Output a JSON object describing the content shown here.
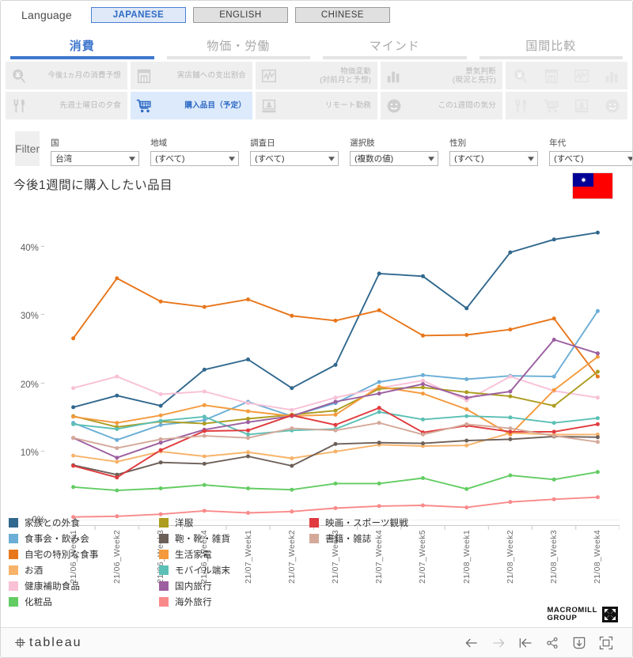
{
  "language": {
    "label": "Language",
    "options": [
      {
        "label": "JAPANESE",
        "active": true
      },
      {
        "label": "ENGLISH",
        "active": false
      },
      {
        "label": "CHINESE",
        "active": false
      }
    ]
  },
  "tabs": [
    {
      "label": "消費",
      "active": true
    },
    {
      "label": "物価・労働",
      "active": false
    },
    {
      "label": "マインド",
      "active": false
    },
    {
      "label": "国間比較",
      "active": false
    }
  ],
  "button_rows": [
    [
      {
        "label": "今後1ヵ月の消費予想",
        "icon": "yen-magnifier-icon",
        "selected": false
      },
      {
        "label": "実店舗への支出割合",
        "icon": "store-icon",
        "selected": false
      },
      {
        "label": "物価変動\n(対前月と予想)",
        "icon": "line-chart-icon",
        "selected": false
      },
      {
        "label": "景気判断\n(現況と先行)",
        "icon": "bar-chart-icon",
        "selected": false
      },
      {
        "label": "",
        "icon": "icon-set-row1",
        "selected": false
      }
    ],
    [
      {
        "label": "先週土曜日の夕食",
        "icon": "cutlery-icon",
        "selected": false
      },
      {
        "label": "購入品目（予定）",
        "icon": "shopping-cart-icon",
        "selected": true
      },
      {
        "label": "リモート勤務",
        "icon": "laptop-person-icon",
        "selected": false
      },
      {
        "label": "この1週間の気分",
        "icon": "smiley-icon",
        "selected": false
      },
      {
        "label": "",
        "icon": "icon-set-row2",
        "selected": false
      }
    ]
  ],
  "filter": {
    "tag_label": "Filter",
    "controls": [
      {
        "label": "国",
        "value": "台湾"
      },
      {
        "label": "地域",
        "value": "(すべて)"
      },
      {
        "label": "調査日",
        "value": "(すべて)"
      },
      {
        "label": "選択肢",
        "value": "(複数の値)"
      },
      {
        "label": "性別",
        "value": "(すべて)"
      },
      {
        "label": "年代",
        "value": "(すべて)"
      }
    ]
  },
  "flag": {
    "name": "taiwan-flag",
    "red": "#fe0000",
    "blue": "#000095"
  },
  "macromill": {
    "line1": "MACROMILL",
    "line2": "GROUP"
  },
  "footer": {
    "logo": "tableau",
    "icons": [
      "back-arrow-icon",
      "forward-arrow-icon",
      "revert-icon",
      "share-icon",
      "download-icon",
      "fullscreen-icon"
    ]
  },
  "chart_data": {
    "type": "line",
    "title": "今後1週間に購入したい品目",
    "xlabel": "",
    "ylabel": "",
    "ylim": [
      0,
      45
    ],
    "yticks": [
      0,
      10,
      20,
      30,
      40
    ],
    "ytick_labels": [
      "0%",
      "10%",
      "20%",
      "30%",
      "40%"
    ],
    "grid": false,
    "legend_position": "bottom",
    "categories": [
      "21/06_Week1",
      "21/06_Week2",
      "21/06_Week3",
      "21/06_Week4",
      "21/07_Week1",
      "21/07_Week2",
      "21/07_Week3",
      "21/07_Week4",
      "21/07_Week5",
      "21/08_Week1",
      "21/08_Week2",
      "21/08_Week3",
      "21/08_Week4"
    ],
    "series": [
      {
        "name": "家族との外食",
        "color": "#31688e",
        "values": [
          16.6,
          18.3,
          16.8,
          22.1,
          23.6,
          19.4,
          22.8,
          36.2,
          35.8,
          31.1,
          39.3,
          41.2,
          42.2
        ]
      },
      {
        "name": "食事会・飲み会",
        "color": "#6baed6",
        "values": [
          14.3,
          11.8,
          14.0,
          14.7,
          17.4,
          15.3,
          17.2,
          20.3,
          21.3,
          20.7,
          21.2,
          21.1,
          30.7
        ]
      },
      {
        "name": "自宅の特別な食事",
        "color": "#e8761b",
        "values": [
          26.7,
          35.5,
          32.1,
          31.3,
          32.4,
          30.0,
          29.3,
          30.8,
          27.1,
          27.2,
          28.0,
          29.6,
          21.1
        ]
      },
      {
        "name": "お酒",
        "color": "#f7b36a",
        "values": [
          9.5,
          8.6,
          10.1,
          9.4,
          10.0,
          9.1,
          10.1,
          11.1,
          10.9,
          11.0,
          12.8,
          12.6,
          12.6
        ]
      },
      {
        "name": "健康補助食品",
        "color": "#f9c0d6",
        "values": [
          19.4,
          21.1,
          18.5,
          18.9,
          17.2,
          16.2,
          18.0,
          19.4,
          20.5,
          17.6,
          21.1,
          19.0,
          18.0
        ]
      },
      {
        "name": "化粧品",
        "color": "#63cc63",
        "values": [
          4.9,
          4.4,
          4.7,
          5.2,
          4.7,
          4.5,
          5.4,
          5.4,
          6.2,
          4.6,
          6.6,
          6.0,
          7.1
        ]
      },
      {
        "name": "洋服",
        "color": "#ad9c1f",
        "values": [
          15.3,
          13.7,
          14.5,
          14.2,
          14.9,
          15.5,
          16.1,
          19.3,
          19.5,
          18.8,
          18.2,
          16.8,
          21.8
        ]
      },
      {
        "name": "鞄・靴・雑貨",
        "color": "#6c5f58",
        "values": [
          8.1,
          6.7,
          8.5,
          8.3,
          9.4,
          8.0,
          11.2,
          11.4,
          11.3,
          11.7,
          11.9,
          12.3,
          12.2
        ]
      },
      {
        "name": "生活家電",
        "color": "#f49a3c",
        "values": [
          15.2,
          14.3,
          15.4,
          16.9,
          16.0,
          15.3,
          15.5,
          19.6,
          18.6,
          16.3,
          12.6,
          19.1,
          24.0
        ]
      },
      {
        "name": "モバイル端末",
        "color": "#5bbfb5",
        "values": [
          14.1,
          13.4,
          14.6,
          15.2,
          12.6,
          13.2,
          13.4,
          15.9,
          14.8,
          15.3,
          15.1,
          14.3,
          15.0
        ]
      },
      {
        "name": "国内旅行",
        "color": "#9c5fa0",
        "values": [
          12.1,
          9.2,
          11.4,
          13.3,
          14.4,
          15.3,
          17.4,
          18.6,
          20.0,
          18.0,
          18.9,
          26.5,
          24.5
        ]
      },
      {
        "name": "海外旅行",
        "color": "#f98a8a",
        "values": [
          0.5,
          0.6,
          0.9,
          1.4,
          1.1,
          1.3,
          1.8,
          2.1,
          2.2,
          1.9,
          2.7,
          3.1,
          3.4
        ]
      },
      {
        "name": "映画・スポーツ観戦",
        "color": "#e03a3e",
        "values": [
          8.0,
          6.3,
          10.3,
          13.1,
          13.2,
          15.4,
          14.0,
          16.5,
          12.9,
          13.9,
          13.0,
          13.0,
          14.1
        ]
      },
      {
        "name": "書籍・雑誌",
        "color": "#d4a99a",
        "values": [
          12.1,
          10.6,
          11.9,
          12.4,
          12.1,
          13.5,
          13.2,
          14.3,
          12.6,
          14.1,
          13.5,
          12.4,
          11.5
        ]
      }
    ],
    "legend_columns": [
      [
        "家族との外食",
        "食事会・飲み会",
        "自宅の特別な食事",
        "お酒",
        "健康補助食品",
        "化粧品"
      ],
      [
        "洋服",
        "鞄・靴・雑貨",
        "生活家電",
        "モバイル端末",
        "国内旅行",
        "海外旅行"
      ],
      [
        "映画・スポーツ観戦",
        "書籍・雑誌"
      ]
    ]
  }
}
